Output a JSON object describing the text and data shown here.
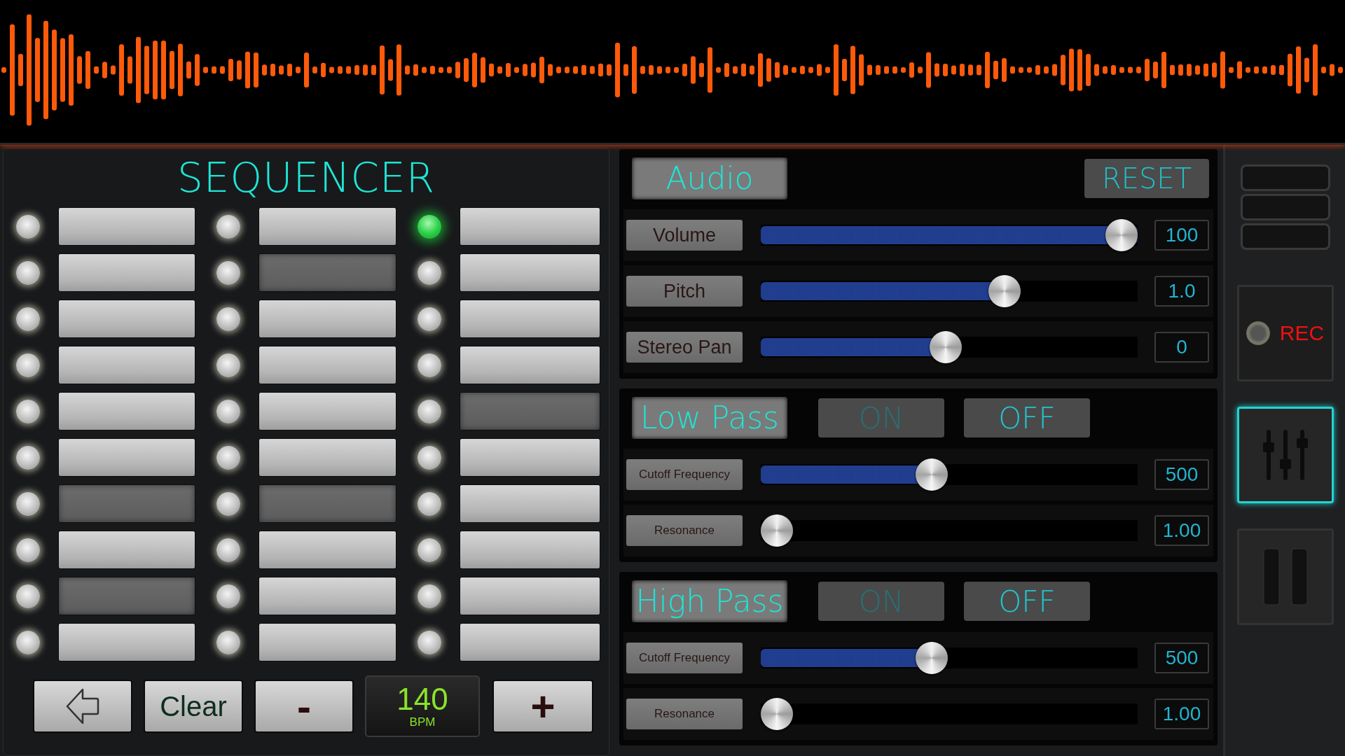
{
  "sequencer": {
    "title": "SEQUENCER",
    "columns": [
      {
        "steps": [
          {
            "on": true,
            "lit": false
          },
          {
            "on": true,
            "lit": false
          },
          {
            "on": true,
            "lit": false
          },
          {
            "on": true,
            "lit": false
          },
          {
            "on": true,
            "lit": false
          },
          {
            "on": true,
            "lit": false
          },
          {
            "on": false,
            "lit": false
          },
          {
            "on": true,
            "lit": false
          },
          {
            "on": false,
            "lit": false
          },
          {
            "on": true,
            "lit": false
          }
        ]
      },
      {
        "steps": [
          {
            "on": true,
            "lit": false
          },
          {
            "on": false,
            "lit": false
          },
          {
            "on": true,
            "lit": false
          },
          {
            "on": true,
            "lit": false
          },
          {
            "on": true,
            "lit": false
          },
          {
            "on": true,
            "lit": false
          },
          {
            "on": false,
            "lit": false
          },
          {
            "on": true,
            "lit": false
          },
          {
            "on": true,
            "lit": false
          },
          {
            "on": true,
            "lit": false
          }
        ]
      },
      {
        "steps": [
          {
            "on": true,
            "lit": true
          },
          {
            "on": true,
            "lit": false
          },
          {
            "on": true,
            "lit": false
          },
          {
            "on": true,
            "lit": false
          },
          {
            "on": false,
            "lit": false
          },
          {
            "on": true,
            "lit": false
          },
          {
            "on": true,
            "lit": false
          },
          {
            "on": true,
            "lit": false
          },
          {
            "on": true,
            "lit": false
          },
          {
            "on": true,
            "lit": false
          }
        ]
      }
    ],
    "clear_button": "Clear",
    "minus_button": "-",
    "plus_button": "+",
    "tempo": {
      "value": "140",
      "unit": "BPM"
    }
  },
  "audio": {
    "title": "Audio",
    "reset_button": "RESET",
    "sliders": [
      {
        "label": "Volume",
        "level": 1.0,
        "reading": "100"
      },
      {
        "label": "Pitch",
        "level": 0.66,
        "reading": "1.0"
      },
      {
        "label": "Stereo Pan",
        "level": 0.49,
        "reading": "0"
      }
    ]
  },
  "filters": [
    {
      "title": "Low Pass",
      "toggles": [
        {
          "label": "ON",
          "selected": false
        },
        {
          "label": "OFF",
          "selected": true
        }
      ],
      "sliders": [
        {
          "label": "Cutoff Frequency",
          "level": 0.45,
          "reading": "500"
        },
        {
          "label": "Resonance",
          "level": 0.0,
          "reading": "1.00"
        }
      ]
    },
    {
      "title": "High Pass",
      "toggles": [
        {
          "label": "ON",
          "selected": false
        },
        {
          "label": "OFF",
          "selected": true
        }
      ],
      "sliders": [
        {
          "label": "Cutoff Frequency",
          "level": 0.45,
          "reading": "500"
        },
        {
          "label": "Resonance",
          "level": 0.0,
          "reading": "1.00"
        }
      ]
    }
  ],
  "sidebar": {
    "rec_label": "REC",
    "buttons": [
      {
        "kind": "mixer",
        "selected": true
      },
      {
        "kind": "pause",
        "selected": false
      }
    ]
  }
}
